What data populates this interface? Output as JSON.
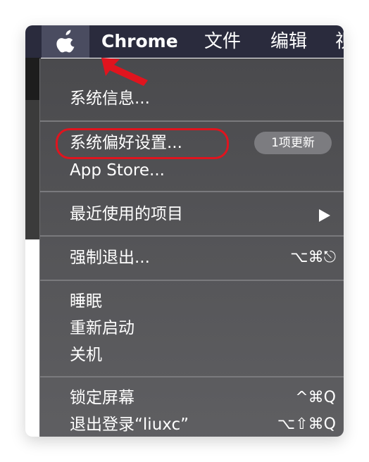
{
  "menubar": {
    "app_name": "Chrome",
    "items": [
      "文件",
      "编辑",
      "视"
    ]
  },
  "apple_menu": {
    "items": [
      {
        "label": "系统信息..."
      },
      {
        "label": "系统偏好设置...",
        "badge": "1项更新"
      },
      {
        "label": "App Store..."
      },
      {
        "label": "最近使用的项目",
        "submenu": true
      },
      {
        "label": "强制退出...",
        "shortcut": "⌥⌘⎋"
      },
      {
        "label": "睡眠"
      },
      {
        "label": "重新启动"
      },
      {
        "label": "关机"
      },
      {
        "label": "锁定屏幕",
        "shortcut": "^⌘Q"
      },
      {
        "label": "退出登录“liuxc”",
        "shortcut": "⌥⇧⌘Q"
      }
    ]
  },
  "colors": {
    "menubar": "#2a2b3d",
    "menu_background": "#555558",
    "highlight_annotation": "#e0141e"
  }
}
